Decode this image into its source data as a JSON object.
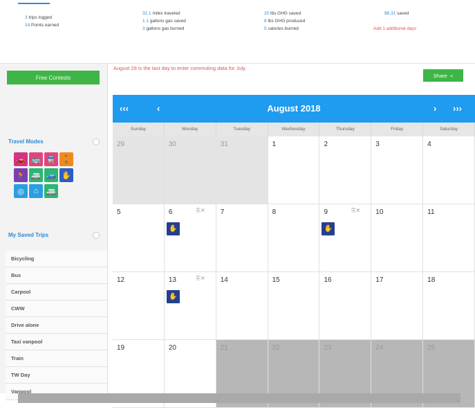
{
  "stats": {
    "col1": [
      {
        "num": "3",
        "text": "trips logged"
      },
      {
        "num": "14",
        "text": "Points earned"
      }
    ],
    "col2": [
      {
        "num": "32.1",
        "text": "miles traveled"
      },
      {
        "num": "1.1",
        "text": "gallons gas saved"
      },
      {
        "num": "3",
        "text": "gallons gas burned"
      }
    ],
    "col3": [
      {
        "num": "20",
        "text": "lbs GHG saved"
      },
      {
        "num": "8",
        "text": "lbs GHG produced"
      },
      {
        "num": "5",
        "text": "calories burned"
      }
    ],
    "col4": [
      {
        "num": "$8.31",
        "text": "saved"
      }
    ],
    "col4_red": "Add 1 additional days"
  },
  "sidebar": {
    "contests_button": "Free Contests",
    "travel_modes_title": "Travel Modes",
    "travel_modes": [
      {
        "icon": "car-icon",
        "glyph": "🚗",
        "color": "#d63384"
      },
      {
        "icon": "bus-icon",
        "glyph": "🚌",
        "color": "#e0457b"
      },
      {
        "icon": "train-icon",
        "glyph": "🚆",
        "color": "#e0457b"
      },
      {
        "icon": "walk-icon",
        "glyph": "🚶",
        "color": "#f08a1f"
      },
      {
        "icon": "run-icon",
        "glyph": "🏃",
        "color": "#7a3fb0"
      },
      {
        "icon": "van-icon",
        "glyph": "🚐",
        "color": "#2bb673"
      },
      {
        "icon": "vanpool-icon",
        "glyph": "🚙",
        "color": "#2bb673"
      },
      {
        "icon": "telework-icon",
        "glyph": "✋",
        "color": "#2d5cc4"
      },
      {
        "icon": "circle-icon",
        "glyph": "◎",
        "color": "#2a9fe0"
      },
      {
        "icon": "home-icon",
        "glyph": "⌂",
        "color": "#2a9fe0"
      },
      {
        "icon": "shuttle-icon",
        "glyph": "🚐",
        "color": "#2bb673"
      }
    ],
    "saved_trips_title": "My Saved Trips",
    "saved_trips": [
      "Bicycling",
      "Bus",
      "Carpool",
      "CWW",
      "Drive alone",
      "Taxi vanpool",
      "Train",
      "TW Day",
      "Vanpool"
    ]
  },
  "main": {
    "notice": "August 29 is the last day to enter commuting data for July.",
    "share_label": "Share",
    "calendar": {
      "month_label": "August 2018",
      "prev_year": "‹‹‹",
      "prev_month": "‹",
      "next_month": "›",
      "next_year": "›››",
      "days_of_week": [
        "Sunday",
        "Monday",
        "Tuesday",
        "Wednesday",
        "Thursday",
        "Friday",
        "Saturday"
      ],
      "weeks": [
        [
          {
            "d": "29",
            "s": "past"
          },
          {
            "d": "30",
            "s": "past"
          },
          {
            "d": "31",
            "s": "past"
          },
          {
            "d": "1"
          },
          {
            "d": "2"
          },
          {
            "d": "3"
          },
          {
            "d": "4"
          }
        ],
        [
          {
            "d": "5"
          },
          {
            "d": "6",
            "trip": true,
            "actions": "⎘✕"
          },
          {
            "d": "7"
          },
          {
            "d": "8"
          },
          {
            "d": "9",
            "trip": true,
            "actions": "⎘✕"
          },
          {
            "d": "10"
          },
          {
            "d": "11"
          }
        ],
        [
          {
            "d": "12"
          },
          {
            "d": "13",
            "trip": true,
            "actions": "⎘✕"
          },
          {
            "d": "14"
          },
          {
            "d": "15"
          },
          {
            "d": "16"
          },
          {
            "d": "17"
          },
          {
            "d": "18"
          }
        ],
        [
          {
            "d": "19"
          },
          {
            "d": "20"
          },
          {
            "d": "21",
            "s": "dark"
          },
          {
            "d": "22",
            "s": "dark"
          },
          {
            "d": "23",
            "s": "dark"
          },
          {
            "d": "24",
            "s": "dark"
          },
          {
            "d": "25",
            "s": "dark"
          }
        ]
      ]
    }
  },
  "colors": {
    "accent_blue": "#1f9bf0",
    "green": "#3fb547",
    "red_text": "#e05252",
    "telework_blue": "#253f8f"
  }
}
